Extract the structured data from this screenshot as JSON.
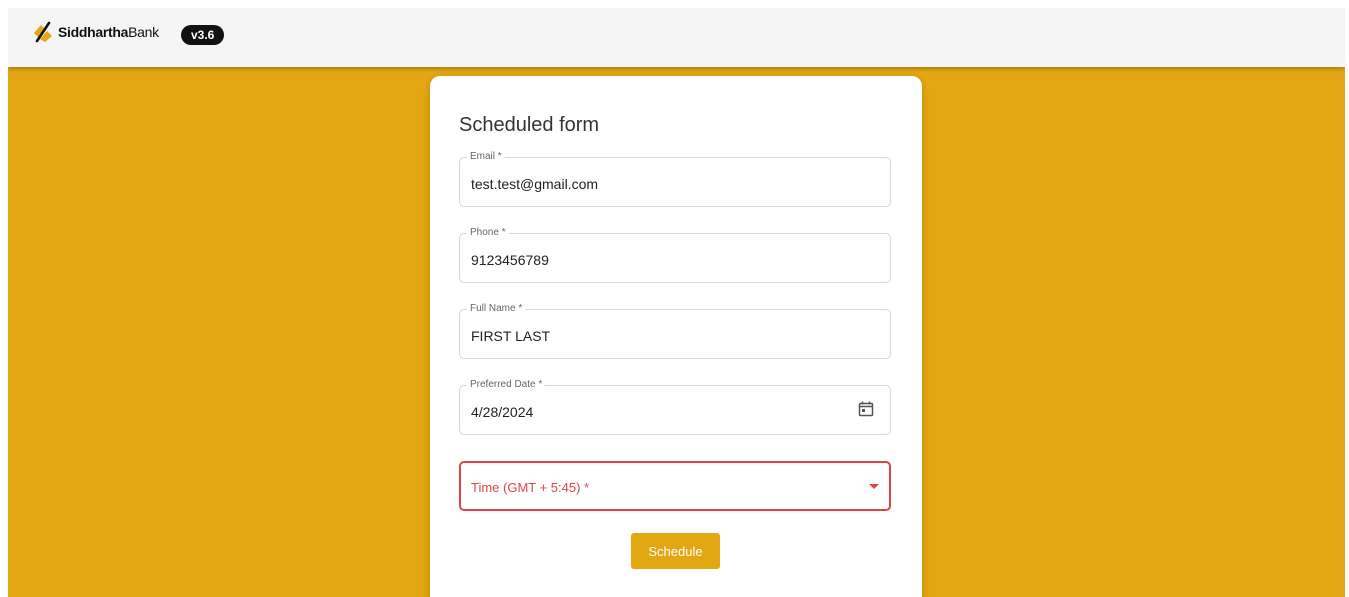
{
  "header": {
    "brand_bold": "Siddhartha",
    "brand_regular": "Bank",
    "version": "v3.6"
  },
  "form": {
    "title": "Scheduled form",
    "fields": [
      {
        "label": "Email *",
        "value": "test.test@gmail.com"
      },
      {
        "label": "Phone *",
        "value": "9123456789"
      },
      {
        "label": "Full Name *",
        "value": "FIRST LAST"
      },
      {
        "label": "Preferred Date *",
        "value": "4/28/2024",
        "icon": "calendar-icon"
      }
    ],
    "time_select": {
      "placeholder": "Time (GMT + 5:45) *",
      "state": "error",
      "icon": "dropdown-caret-icon"
    },
    "submit_label": "Schedule"
  },
  "colors": {
    "brand_yellow": "#e3a713",
    "error_red": "#e04545",
    "topbar_bg": "#f5f5f5"
  }
}
